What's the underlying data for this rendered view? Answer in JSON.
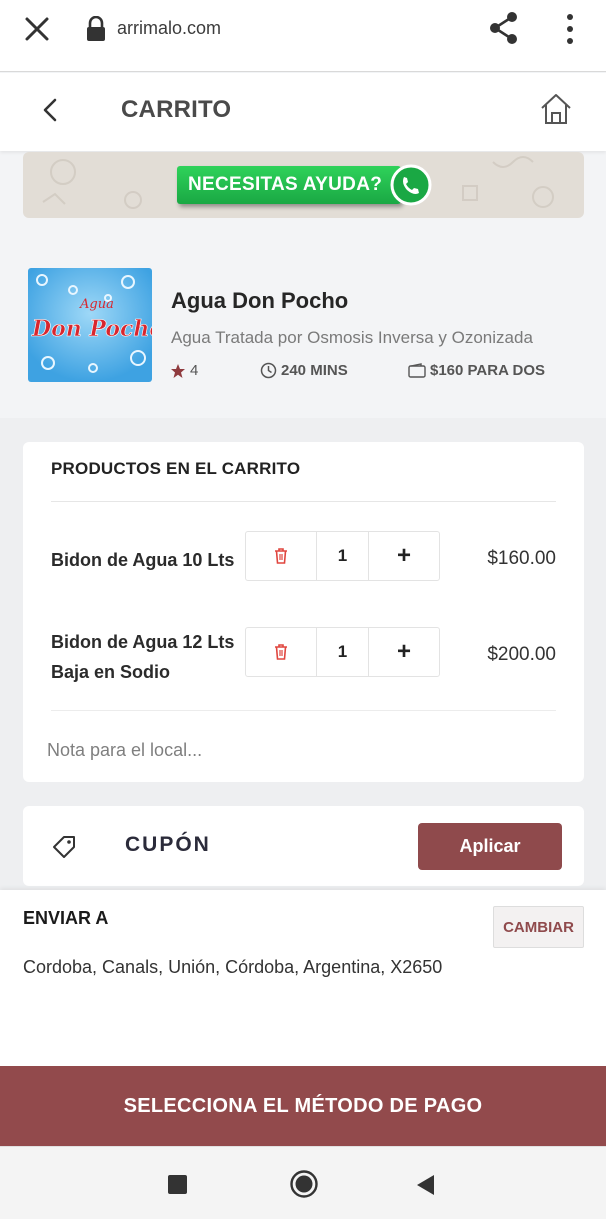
{
  "browser": {
    "url": "arrimalo.com"
  },
  "header": {
    "title": "CARRITO"
  },
  "help_banner": {
    "label": "NECESITAS AYUDA?"
  },
  "store": {
    "name": "Agua Don Pocho",
    "description": "Agua Tratada por Osmosis Inversa y Ozonizada",
    "rating": "4",
    "time": "240 MINS",
    "price_for_two": "$160 PARA DOS",
    "logo_text_top": "Agua",
    "logo_text_main": "Don Pocho"
  },
  "cart": {
    "heading": "PRODUCTOS EN EL CARRITO",
    "items": [
      {
        "name": "Bidon de Agua 10 Lts",
        "quantity": "1",
        "add_label": "+",
        "price": "$160.00"
      },
      {
        "name_line1": "Bidon de Agua 12 Lts",
        "name_line2": "Baja en Sodio",
        "quantity": "1",
        "add_label": "+",
        "price": "$200.00"
      }
    ],
    "note_placeholder": "Nota para el local..."
  },
  "coupon": {
    "label": "CUPÓN",
    "apply_label": "Aplicar"
  },
  "shipping": {
    "label": "ENVIAR A",
    "change_label": "CAMBIAR",
    "address": "Cordoba, Canals, Unión, Córdoba, Argentina, X2650"
  },
  "checkout": {
    "pay_label": "SELECCIONA EL MÉTODO DE PAGO"
  },
  "colors": {
    "brand": "#924a4c",
    "whatsapp": "#1aa844",
    "delete_icon": "#e0463f"
  }
}
